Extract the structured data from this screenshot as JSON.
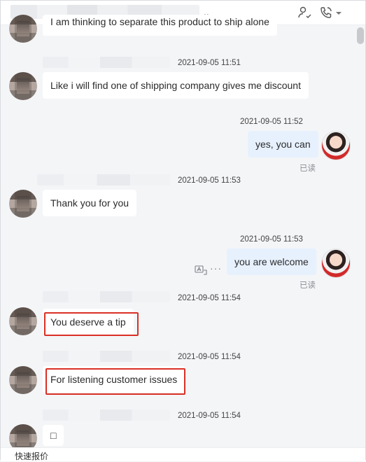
{
  "header": {
    "contact_suffix": "..",
    "icons": [
      "add-contact-icon",
      "phone-icon",
      "chevron-down-icon"
    ]
  },
  "messages": [
    {
      "side": "left",
      "text": "I am thinking to separate this product to ship alone"
    },
    {
      "side": "left",
      "time": "2021-09-05 11:51",
      "text": "Like i will find one of shipping company gives me discount"
    },
    {
      "side": "right",
      "time": "2021-09-05 11:52",
      "text": "yes, you can",
      "status": "已读"
    },
    {
      "side": "left",
      "time": "2021-09-05 11:53",
      "text": "Thank you for you"
    },
    {
      "side": "right",
      "time": "2021-09-05 11:53",
      "text": "you are welcome",
      "status": "已读"
    },
    {
      "side": "left",
      "time": "2021-09-05 11:54",
      "text": "You deserve a tip",
      "highlighted": true
    },
    {
      "side": "left",
      "time": "2021-09-05 11:54",
      "text": "For listening customer issues",
      "highlighted": true
    },
    {
      "side": "left",
      "time": "2021-09-05 11:54",
      "text": "□"
    }
  ],
  "footer": {
    "quick_quote": "快速报价"
  },
  "colors": {
    "highlight": "#d93025",
    "mine_bubble": "#e7f1fe"
  }
}
